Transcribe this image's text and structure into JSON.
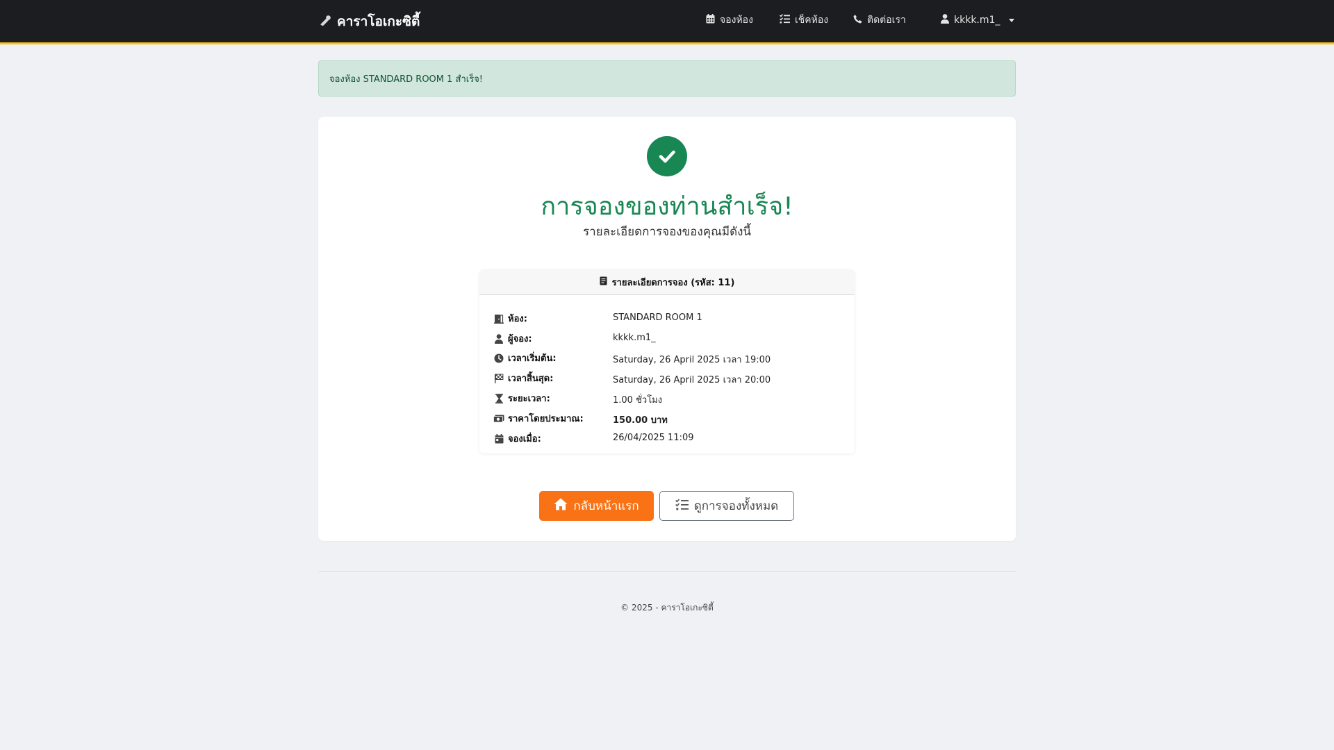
{
  "navbar": {
    "brand": "คาราโอเกะซิตี้",
    "brand_icon": "microphone-icon",
    "links": [
      {
        "label": "จองห้อง",
        "icon": "calendar-icon"
      },
      {
        "label": "เช็คห้อง",
        "icon": "list-check-icon"
      },
      {
        "label": "ติดต่อเรา",
        "icon": "phone-icon"
      }
    ],
    "user": {
      "label": "kkkk.m1_",
      "icon": "user-icon"
    }
  },
  "alert": {
    "text": "จองห้อง STANDARD ROOM 1 สำเร็จ!"
  },
  "success": {
    "icon": "check-circle-icon",
    "title": "การจองของท่านสำเร็จ!",
    "subtitle": "รายละเอียดการจองของคุณมีดังนี้"
  },
  "details": {
    "header": "รายละเอียดการจอง (รหัส: 11)",
    "rows": [
      {
        "icon": "door-icon",
        "label": "ห้อง:",
        "value": "STANDARD ROOM 1"
      },
      {
        "icon": "user-icon",
        "label": "ผู้จอง:",
        "value": "kkkk.m1_"
      },
      {
        "icon": "clock-icon",
        "label": "เวลาเริ่มต้น:",
        "value": "Saturday, 26 April 2025 เวลา 19:00"
      },
      {
        "icon": "flag-checkered-icon",
        "label": "เวลาสิ้นสุด:",
        "value": "Saturday, 26 April 2025 เวลา 20:00"
      },
      {
        "icon": "hourglass-icon",
        "label": "ระยะเวลา:",
        "value": "1.00 ชั่วโมง"
      },
      {
        "icon": "money-icon",
        "label": "ราคาโดยประมาณ:",
        "value": "150.00 บาท"
      },
      {
        "icon": "calendar-day-icon",
        "label": "จองเมื่อ:",
        "value": "26/04/2025 11:09"
      }
    ]
  },
  "buttons": {
    "home": "กลับหน้าแรก",
    "all_bookings": "ดูการจองทั้งหมด"
  },
  "footer": {
    "text": "© 2025 - คาราโอเกะซิตี้"
  },
  "colors": {
    "navbar_bg": "#1c1d21",
    "navbar_accent": "#f4c21f",
    "success_green": "#198754",
    "alert_bg": "#d1e7dd",
    "primary_orange": "#f97316"
  }
}
